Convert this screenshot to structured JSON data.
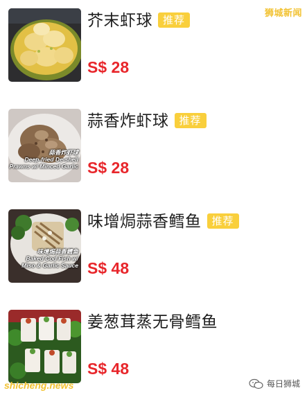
{
  "watermark": {
    "top_right": "狮城新闻",
    "bottom_left": "shicheng.news",
    "bottom_right": "每日狮城"
  },
  "badge_label": "推荐",
  "items": [
    {
      "name": "芥末虾球",
      "price": "S$ 28",
      "recommended": true,
      "photo_caption": []
    },
    {
      "name": "蒜香炸虾球",
      "price": "S$ 28",
      "recommended": true,
      "photo_caption": [
        "蒜香炸虾球",
        "Deep-fried De-shell",
        "Prawns w/ Minced Garlic"
      ]
    },
    {
      "name": "味增焗蒜香鳕鱼",
      "price": "S$ 48",
      "recommended": true,
      "photo_caption": [
        "味增焗蒜香鳕鱼",
        "Baked Cod Fish w/",
        "Miso & Garlic Sauce"
      ]
    },
    {
      "name": "姜葱茸蒸无骨鳕鱼",
      "price": "S$ 48",
      "recommended": false,
      "photo_caption": []
    }
  ],
  "colors": {
    "price": "#e8262b",
    "badge": "#f9cf3c",
    "watermark": "#f2c232"
  }
}
